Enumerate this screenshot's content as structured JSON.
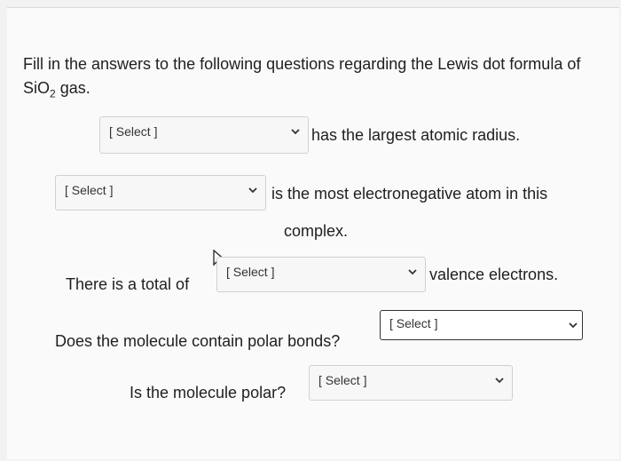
{
  "intro": "Fill in the answers to the following questions regarding the Lewis dot formula of SiO2 gas.",
  "intro_parts": {
    "before": "Fill in the answers to the following questions regarding the Lewis dot formula of SiO",
    "sub": "2",
    "after": " gas."
  },
  "questions": [
    {
      "select_value": "[ Select ]",
      "text_after": "has the largest atomic radius."
    },
    {
      "select_value": "[ Select ]",
      "text_after": "is the most electronegative atom in this",
      "text_after_2": "complex."
    },
    {
      "text_before": "There is a total of",
      "select_value": "[ Select ]",
      "text_after": "valence electrons."
    },
    {
      "text_before": "Does the molecule contain polar bonds?",
      "select_value": "[ Select ]"
    },
    {
      "text_before": "Is the molecule polar?",
      "select_value": "[ Select ]"
    }
  ],
  "icons": {
    "dropdown": "chevron-down-icon",
    "cursor": "mouse-pointer-icon"
  }
}
